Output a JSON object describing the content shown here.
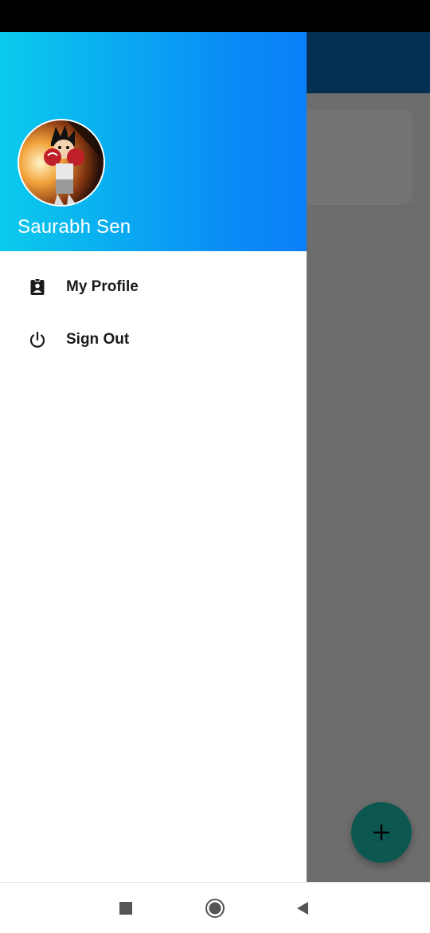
{
  "drawer": {
    "header": {
      "user_name": "Saurabh Sen",
      "gradient": [
        "#0bcbec",
        "#0a7ff8"
      ]
    },
    "menu_items": [
      {
        "label": "My Profile",
        "icon": "assignment-ind-icon"
      },
      {
        "label": "Sign Out",
        "icon": "power-icon"
      }
    ]
  },
  "background_app": {
    "toolbar_color": "#0a6cb8",
    "fab": {
      "icon": "plus-icon",
      "color": "#1bc4b4"
    }
  },
  "nav_bar": {
    "buttons": [
      "recents-square-icon",
      "home-circle-icon",
      "back-triangle-icon"
    ]
  }
}
